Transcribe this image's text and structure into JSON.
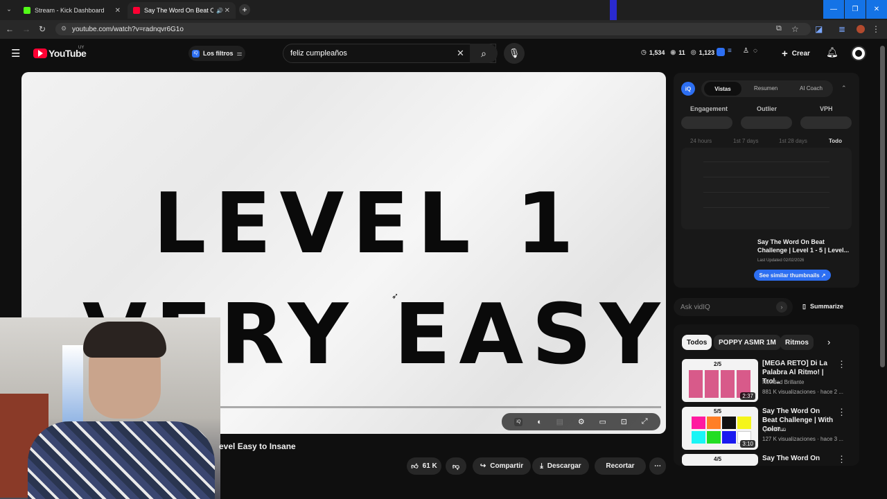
{
  "browser": {
    "tabs": [
      {
        "label": "Stream - Kick Dashboard",
        "favicon_color": "#53fc18"
      },
      {
        "label": "Say The Word On Beat Cha",
        "favicon_color": "#ff0033"
      }
    ],
    "url": "youtube.com/watch?v=radnqvr6G1o"
  },
  "youtube": {
    "logo_text": "YouTube",
    "region": "UY",
    "filters_label": "Los filtros",
    "search_value": "feliz cumpleaños",
    "stats": {
      "time": "1,534",
      "views": "11",
      "items": "1,123"
    },
    "create_label": "Crear"
  },
  "video": {
    "line1": "LEVEL 1",
    "line2": "VERY EASY",
    "title_visible": "evel Easy to Insane",
    "likes": "61 K",
    "share_label": "Compartir",
    "download_label": "Descargar",
    "clip_label": "Recortar"
  },
  "vidiq": {
    "logo": "iQ",
    "tabs": [
      "Vistas",
      "Resumen",
      "AI Coach"
    ],
    "metrics": [
      "Engagement",
      "Outlier",
      "VPH"
    ],
    "ranges": [
      "24 hours",
      "1st 7 days",
      "1st 28 days",
      "Todo"
    ],
    "video_title": "Say The Word On Beat Challenge | Level 1 - 5 | Level...",
    "updated": "Last Updated 02/02/2026",
    "similar_btn": "See similar thumbnails ↗",
    "ask_placeholder": "Ask vidIQ",
    "summarize_label": "Summarize"
  },
  "chips": [
    "Todos",
    "POPPY ASMR 1M",
    "Ritmos"
  ],
  "recommendations": [
    {
      "title": "[MEGA RETO] Di La Palabra Al Ritmo! | Trol...",
      "channel": "Navidad Brillante",
      "meta": "881 K visualizaciones · hace 2 ...",
      "duration": "2:37",
      "badge": "2/5"
    },
    {
      "title": "Say The Word On Beat Challenge | With Color...",
      "channel": "QuickFun",
      "meta": "127 K visualizaciones · hace 3 ...",
      "duration": "3:10",
      "badge": "5/5"
    },
    {
      "title": "Say The Word On Beat",
      "channel": "",
      "meta": "",
      "duration": "",
      "badge": "4/5"
    }
  ]
}
